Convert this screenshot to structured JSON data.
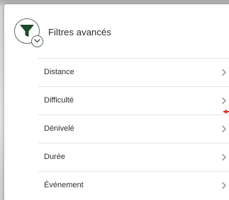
{
  "header": {
    "title": "Filtres avancés",
    "icon": "filter-funnel-icon",
    "badge_icon": "chevron-down-icon",
    "accent_color": "#1f4a2a"
  },
  "filters": {
    "items": [
      {
        "label": "Distance"
      },
      {
        "label": "Difficulté"
      },
      {
        "label": "Dénivelé"
      },
      {
        "label": "Durée"
      },
      {
        "label": "Événement"
      }
    ],
    "chevron_icon": "chevron-right-icon"
  },
  "annotation": {
    "color": "#d8382a",
    "icon": "red-arrow-pointer"
  }
}
